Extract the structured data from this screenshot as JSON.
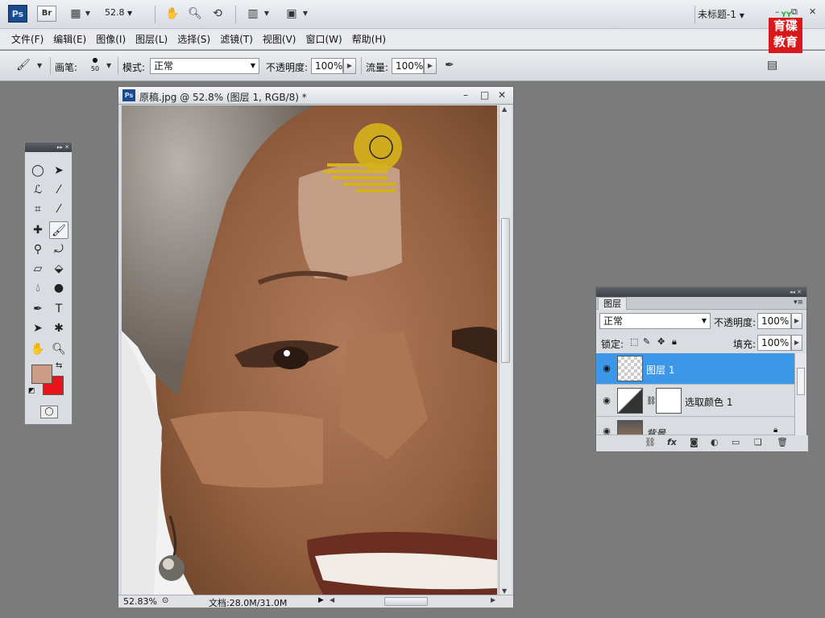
{
  "app": {
    "logo": "Ps",
    "bridge": "Br",
    "zoom": "52.8",
    "doc_title": "未标题-1",
    "brand_top": "YY",
    "brand_text": "育碟教育"
  },
  "menu": [
    "文件(F)",
    "编辑(E)",
    "图像(I)",
    "图层(L)",
    "选择(S)",
    "滤镜(T)",
    "视图(V)",
    "窗口(W)",
    "帮助(H)"
  ],
  "options": {
    "brush_label": "画笔:",
    "brush_size": "50",
    "mode_label": "模式:",
    "mode_value": "正常",
    "opacity_label": "不透明度:",
    "opacity_value": "100%",
    "flow_label": "流量:",
    "flow_value": "100%"
  },
  "document": {
    "icon": "Ps",
    "title": "原稿.jpg @ 52.8% (图层 1, RGB/8) *",
    "status_zoom": "52.83%",
    "status_doc": "文档:28.0M/31.0M"
  },
  "layers_panel": {
    "tab": "图层",
    "blend_mode": "正常",
    "opacity_label": "不透明度:",
    "opacity_value": "100%",
    "lock_label": "锁定:",
    "fill_label": "填充:",
    "fill_value": "100%",
    "layers": [
      {
        "name": "图层 1",
        "selected": true
      },
      {
        "name": "选取颜色 1",
        "selected": false
      },
      {
        "name": "背景",
        "selected": false
      }
    ]
  },
  "colors": {
    "foreground": "#cd9c86",
    "background": "#e8141a",
    "selection": "#3c97e8"
  }
}
